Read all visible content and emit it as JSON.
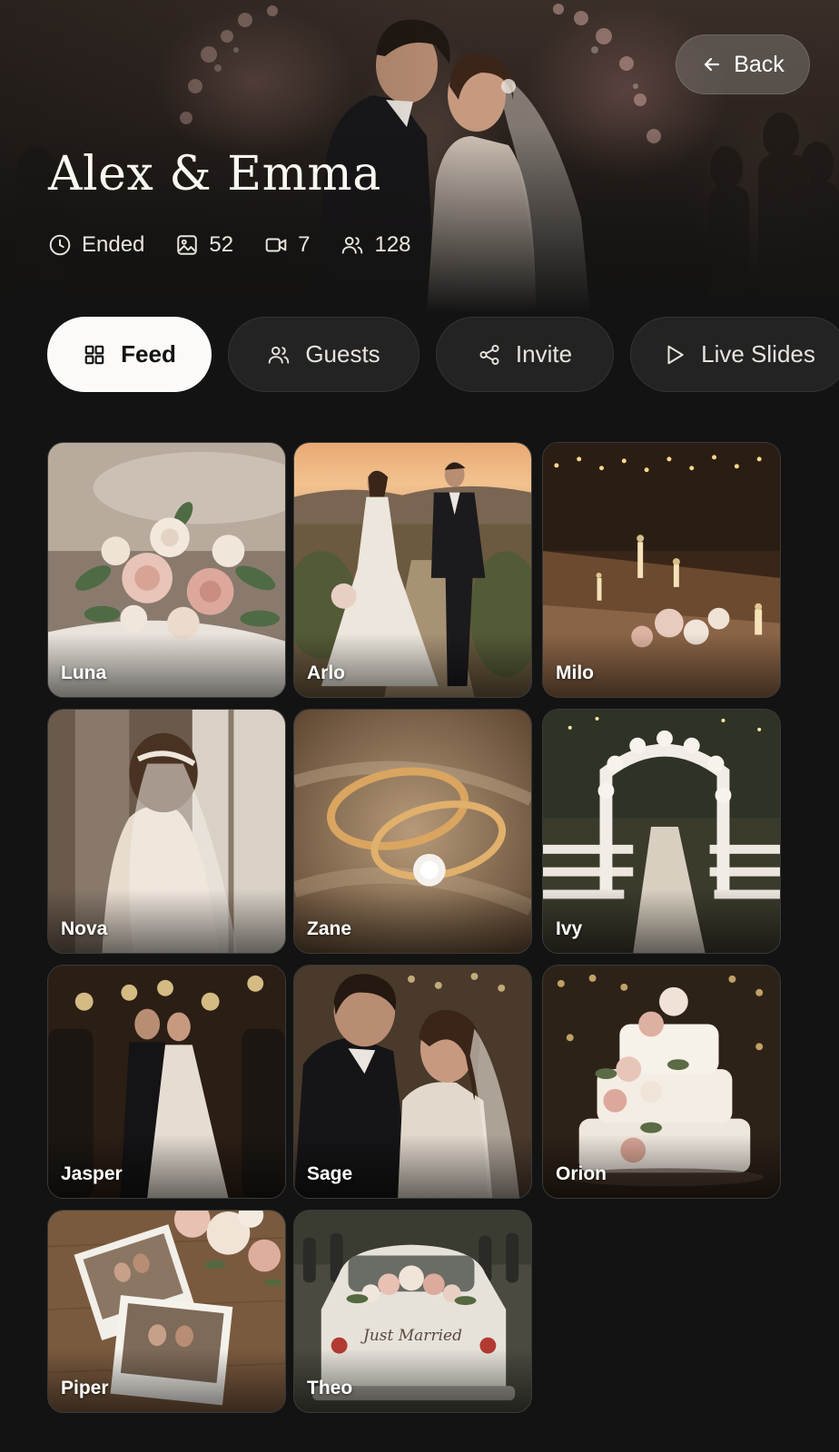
{
  "header": {
    "back_label": "Back",
    "title": "Alex & Emma",
    "stats": {
      "status": "Ended",
      "photos": "52",
      "videos": "7",
      "guests": "128"
    }
  },
  "tabs": [
    {
      "label": "Feed",
      "active": true,
      "icon": "grid-icon"
    },
    {
      "label": "Guests",
      "active": false,
      "icon": "users-icon"
    },
    {
      "label": "Invite",
      "active": false,
      "icon": "share-icon"
    },
    {
      "label": "Live Slides",
      "active": false,
      "icon": "play-icon"
    }
  ],
  "feed": [
    {
      "name": "Luna",
      "subject": "bridal bouquet"
    },
    {
      "name": "Arlo",
      "subject": "couple walking at sunset"
    },
    {
      "name": "Milo",
      "subject": "candlelit reception table"
    },
    {
      "name": "Nova",
      "subject": "bride veil by window"
    },
    {
      "name": "Zane",
      "subject": "wedding rings"
    },
    {
      "name": "Ivy",
      "subject": "floral ceremony arch aisle"
    },
    {
      "name": "Jasper",
      "subject": "sparkler send-off kiss"
    },
    {
      "name": "Sage",
      "subject": "couple embrace"
    },
    {
      "name": "Orion",
      "subject": "wedding cake"
    },
    {
      "name": "Piper",
      "subject": "polaroid photos with flowers"
    },
    {
      "name": "Theo",
      "subject": "just married car"
    }
  ],
  "car_sign": "Just Married",
  "colors": {
    "background": "#131313",
    "active_tab": "#fbfaf8",
    "tab_bg": "#232323",
    "text": "#f2ede6"
  }
}
